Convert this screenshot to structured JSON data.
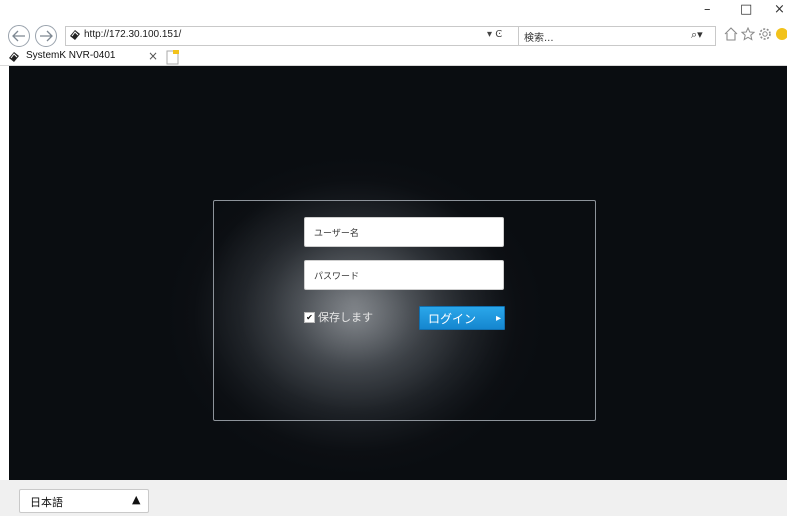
{
  "browser": {
    "window_controls": {
      "minimize": "–",
      "maximize": "□",
      "close": "×"
    },
    "address_url": "http://172.30.100.151/",
    "search_placeholder": "検索...",
    "search_icon": "⌕▾",
    "refresh_icon": "▾ Ͼ",
    "tab_title": "SystemK NVR-0401",
    "tab_close": "×"
  },
  "login": {
    "username_placeholder": "ユーザー名",
    "password_placeholder": "パスワード",
    "remember_label": "保存します",
    "remember_checked": true,
    "login_button": "ログイン",
    "login_arrow": "▸"
  },
  "footer": {
    "language_selected": "日本語",
    "language_arrow": "▲"
  },
  "colors": {
    "page_bg": "#0a0d11",
    "login_button": "#1e96de",
    "panel_border": "#8d939a"
  }
}
